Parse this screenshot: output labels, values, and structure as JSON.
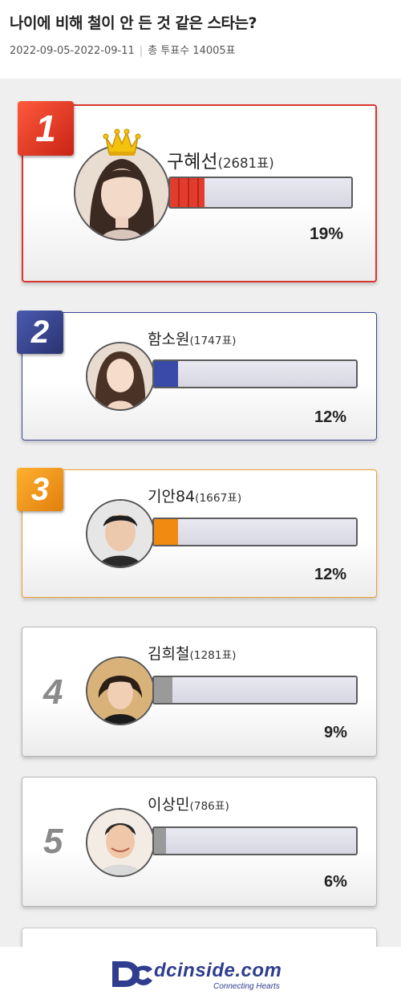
{
  "poll": {
    "title": "나이에 비해 철이 안 든 것 같은 스타는?",
    "period": "2022-09-05-2022-09-11",
    "total_votes": "총 투표수 14005표"
  },
  "results": [
    {
      "rank": "1",
      "name": "구혜선",
      "votes": "(2681표)",
      "percent": "19%",
      "share": 0.19,
      "color": "#e23d2c"
    },
    {
      "rank": "2",
      "name": "함소원",
      "votes": "(1747표)",
      "percent": "12%",
      "share": 0.12,
      "color": "#3a4aa8"
    },
    {
      "rank": "3",
      "name": "기안84",
      "votes": "(1667표)",
      "percent": "12%",
      "share": 0.12,
      "color": "#f08a10"
    },
    {
      "rank": "4",
      "name": "김희철",
      "votes": "(1281표)",
      "percent": "9%",
      "share": 0.09,
      "color": "#9a9a9a"
    },
    {
      "rank": "5",
      "name": "이상민",
      "votes": "(786표)",
      "percent": "6%",
      "share": 0.06,
      "color": "#9a9a9a"
    }
  ],
  "icons": {
    "crown": "crown-icon",
    "logo": "dcinside-logo"
  },
  "footer": {
    "logo_text": "dcinside.com",
    "tagline": "Connecting Hearts"
  }
}
